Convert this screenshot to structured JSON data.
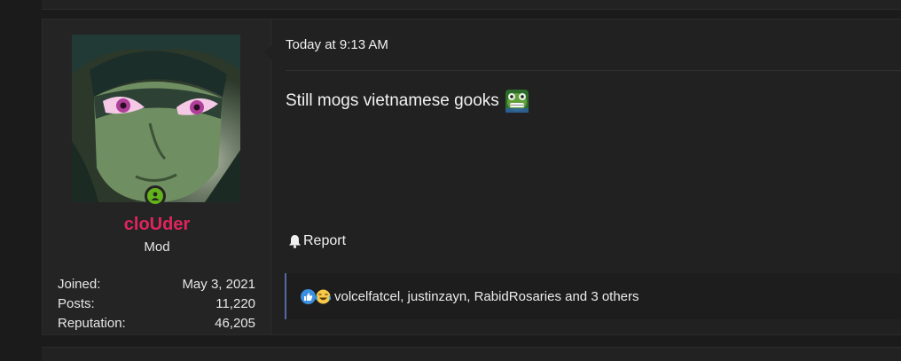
{
  "post": {
    "user": {
      "username": "cloUder",
      "title": "Mod",
      "stats": [
        {
          "label": "Joined:",
          "value": "May 3, 2021"
        },
        {
          "label": "Posts:",
          "value": "11,220"
        },
        {
          "label": "Reputation:",
          "value": "46,205"
        }
      ],
      "avatar_icon": "anime-avatar",
      "online_icon": "online-user-icon"
    },
    "timestamp": "Today at 9:13 AM",
    "message": "Still mogs vietnamese gooks",
    "message_emoji_icon": "frog-emoji-icon",
    "report_label": "Report",
    "reactions": {
      "icons": [
        "like-reaction-icon",
        "laugh-cry-reaction-icon"
      ],
      "text": "volcelfatcel, justinzayn, RabidRosaries and 3 others"
    }
  },
  "colors": {
    "username": "#e0245e",
    "online": "#63b21b",
    "reaction_border": "#5567a8",
    "background": "#1b1b1b"
  }
}
